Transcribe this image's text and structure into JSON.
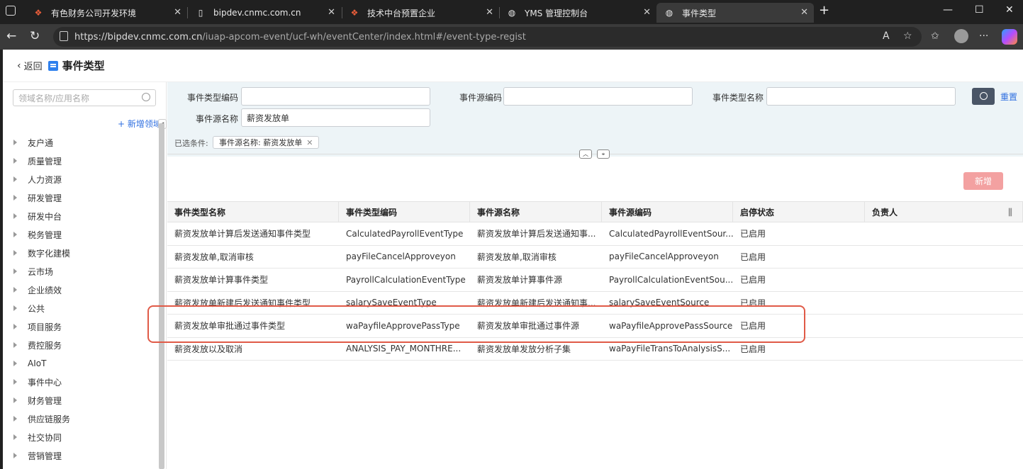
{
  "browser": {
    "tabs": [
      {
        "title": "有色财务公司开发环境",
        "icon": "grid-logo-icon"
      },
      {
        "title": "bipdev.cnmc.com.cn",
        "icon": "page-icon"
      },
      {
        "title": "技术中台预置企业",
        "icon": "grid-logo-icon"
      },
      {
        "title": "YMS 管理控制台",
        "icon": "globe-icon"
      },
      {
        "title": "事件类型",
        "icon": "globe-icon",
        "active": true
      }
    ],
    "url_host": "https://bipdev.cnmc.com.cn",
    "url_path": "/iuap-apcom-event/ucf-wh/eventCenter/index.html#/event-type-regist"
  },
  "header": {
    "back_label": "返回",
    "title": "事件类型"
  },
  "sidebar": {
    "search_placeholder": "领域名称/应用名称",
    "add_domain_label": "+ 新增领域",
    "items": [
      "友户通",
      "质量管理",
      "人力资源",
      "研发管理",
      "研发中台",
      "税务管理",
      "数字化建模",
      "云市场",
      "企业绩效",
      "公共",
      "项目服务",
      "费控服务",
      "AIoT",
      "事件中心",
      "财务管理",
      "供应链服务",
      "社交协同",
      "营销管理"
    ]
  },
  "filter": {
    "type_code_label": "事件类型编码",
    "type_code_value": "",
    "source_code_label": "事件源编码",
    "source_code_value": "",
    "type_name_label": "事件类型名称",
    "type_name_value": "",
    "source_name_label": "事件源名称",
    "source_name_value": "薪资发放单",
    "reset_label": "重置",
    "selected_label": "已选条件:",
    "selected_chip": "事件源名称: 薪资发放单"
  },
  "toolbar": {
    "add_label": "新增"
  },
  "table": {
    "columns": [
      "事件类型名称",
      "事件类型编码",
      "事件源名称",
      "事件源编码",
      "启停状态",
      "负责人"
    ],
    "rows": [
      [
        "薪资发放单计算后发送通知事件类型",
        "CalculatedPayrollEventType",
        "薪资发放单计算后发送通知事...",
        "CalculatedPayrollEventSour...",
        "已启用",
        ""
      ],
      [
        "薪资发放单,取消审核",
        "payFileCancelApproveyon",
        "薪资发放单,取消审核",
        "payFileCancelApproveyon",
        "已启用",
        ""
      ],
      [
        "薪资发放单计算事件类型",
        "PayrollCalculationEventType",
        "薪资发放单计算事件源",
        "PayrollCalculationEventSou...",
        "已启用",
        ""
      ],
      [
        "薪资发放单新建后发送通知事件类型",
        "salarySaveEventType",
        "薪资发放单新建后发送通知事...",
        "salarySaveEventSource",
        "已启用",
        ""
      ],
      [
        "薪资发放单审批通过事件类型",
        "waPayfileApprovePassType",
        "薪资发放单审批通过事件源",
        "waPayfileApprovePassSource",
        "已启用",
        ""
      ],
      [
        "薪资发放以及取消",
        "ANALYSIS_PAY_MONTHRE...",
        "薪资发放单发放分析子集",
        "waPayFileTransToAnalysisS...",
        "已启用",
        ""
      ]
    ]
  },
  "colors": {
    "accent": "#2f6fe0",
    "filter_bg": "#edf4f7",
    "add_button": "#f3a1a1",
    "highlight": "#e05a47"
  }
}
